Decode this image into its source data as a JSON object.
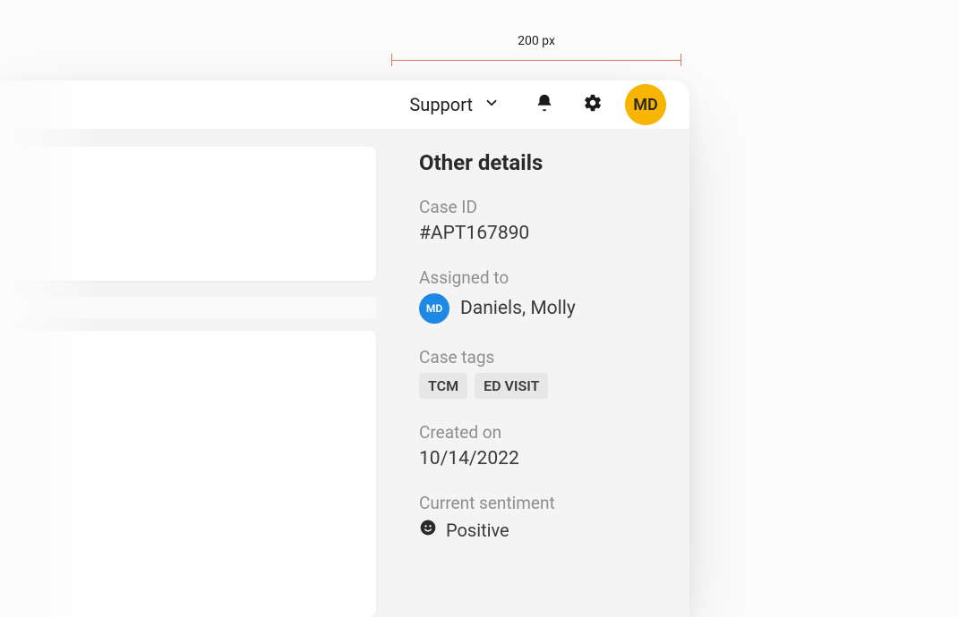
{
  "measure": {
    "label": "200 px"
  },
  "topbar": {
    "support_label": "Support",
    "avatar_initials": "MD"
  },
  "panel": {
    "title": "Other details",
    "case_id": {
      "label": "Case ID",
      "value": "#APT167890"
    },
    "assigned_to": {
      "label": "Assigned to",
      "initials": "MD",
      "name": "Daniels, Molly"
    },
    "case_tags": {
      "label": "Case tags",
      "items": [
        "TCM",
        "ED VISIT"
      ]
    },
    "created_on": {
      "label": "Created on",
      "value": "10/14/2022"
    },
    "sentiment": {
      "label": "Current sentiment",
      "value": "Positive"
    }
  }
}
